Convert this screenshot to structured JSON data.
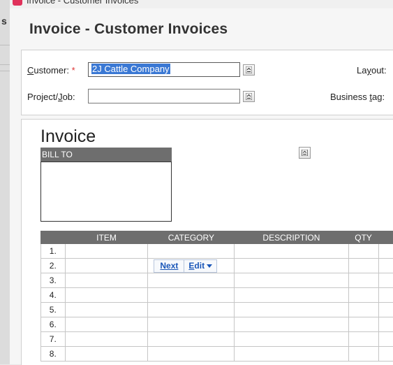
{
  "window": {
    "title": "Invoice - Customer Invoices"
  },
  "page": {
    "title": "Invoice - Customer Invoices"
  },
  "background_window": {
    "fragment": "s"
  },
  "header": {
    "customer": {
      "label_pre": "",
      "label_key": "C",
      "label_rest": "ustomer:",
      "required_mark": "*",
      "value": "2J Cattle Company"
    },
    "project": {
      "label_pre": "Project/",
      "label_key": "J",
      "label_rest": "ob:",
      "value": ""
    },
    "layout": {
      "label_pre": "La",
      "label_key": "y",
      "label_rest": "out:"
    },
    "business_tag": {
      "label_pre": "Business ",
      "label_key": "t",
      "label_rest": "ag:"
    }
  },
  "invoice": {
    "heading": "Invoice",
    "bill_to_label": "BILL TO",
    "columns": [
      "",
      "ITEM",
      "CATEGORY",
      "DESCRIPTION",
      "QTY",
      ""
    ],
    "rows": [
      "1.",
      "2.",
      "3.",
      "4.",
      "5.",
      "6.",
      "7.",
      "8."
    ],
    "row_popup": {
      "next_label": "Next",
      "edit_key": "E",
      "edit_rest": "dit"
    }
  },
  "colors": {
    "accent": "#3a78d4",
    "grid_header": "#6e6e6e",
    "app_icon": "#e0325b",
    "link": "#1a56b8"
  },
  "icons": [
    "app-icon",
    "picker-icon",
    "dropdown-caret-icon"
  ]
}
